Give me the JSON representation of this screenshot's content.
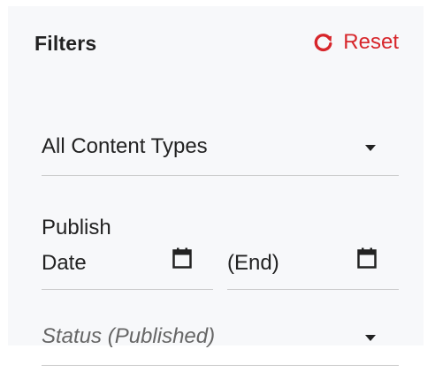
{
  "filters": {
    "title": "Filters",
    "reset_label": "Reset",
    "reset_icon": "refresh-icon",
    "accent_color": "#d7262b"
  },
  "content_type_select": {
    "selected": "All Content Types",
    "icon": "caret-down-icon"
  },
  "publish_date": {
    "start_label": "Publish Date",
    "end_label": "(End)",
    "icon": "calendar-icon"
  },
  "status_select": {
    "placeholder": "Status (Published)",
    "icon": "caret-down-icon"
  }
}
